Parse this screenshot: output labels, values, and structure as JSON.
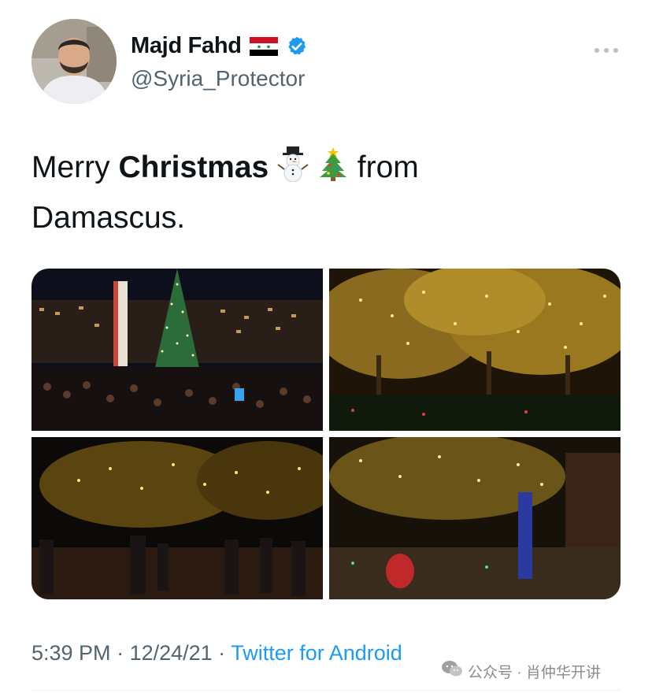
{
  "user": {
    "display_name": "Majd Fahd",
    "handle": "@Syria_Protector",
    "flag_icon": "syria-flag",
    "verified_icon": "verified-badge",
    "verified_color": "#1d9bf0"
  },
  "more_icon": "more-horizontal",
  "tweet": {
    "text_1": "Merry ",
    "text_bold": "Christmas",
    "emoji_1": "snowman",
    "emoji_2": "christmas-tree",
    "text_2": "from",
    "text_3": "Damascus."
  },
  "media_icons": [
    "photo-christmas-tree-square",
    "photo-lit-trees-garden",
    "photo-lit-trees-street",
    "photo-lit-trees-courtyard"
  ],
  "meta": {
    "time": "5:39 PM",
    "sep1": " · ",
    "date": "12/24/21",
    "sep2": " · ",
    "source": "Twitter for Android"
  },
  "watermark": {
    "icon": "wechat-icon",
    "text": "公众号 · 肖仲华开讲"
  },
  "colors": {
    "link": "#1d9bf0",
    "secondary": "#536471",
    "text": "#0f1419"
  }
}
